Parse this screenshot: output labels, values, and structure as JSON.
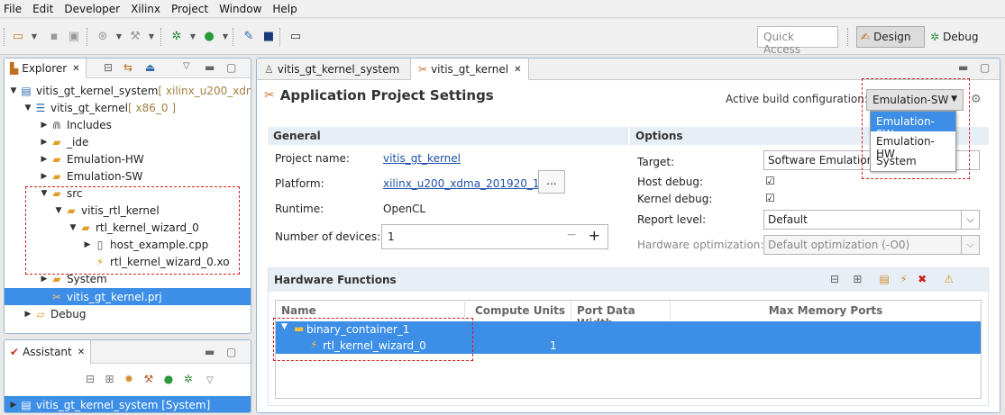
{
  "menu": [
    "File",
    "Edit",
    "Developer",
    "Xilinx",
    "Project",
    "Window",
    "Help"
  ],
  "toolbar": {
    "quick_access_placeholder": "Quick Access",
    "design_label": "Design",
    "debug_label": "Debug"
  },
  "explorer": {
    "tab_label": "Explorer",
    "tree": [
      {
        "label": "vitis_gt_kernel_system",
        "suffix": " [ xilinx_u200_xdm"
      },
      {
        "label": "vitis_gt_kernel",
        "suffix": " [ x86_0 ]"
      },
      {
        "label": "Includes"
      },
      {
        "label": "_ide"
      },
      {
        "label": "Emulation-HW"
      },
      {
        "label": "Emulation-SW"
      },
      {
        "label": "src"
      },
      {
        "label": "vitis_rtl_kernel"
      },
      {
        "label": "rtl_kernel_wizard_0"
      },
      {
        "label": "host_example.cpp"
      },
      {
        "label": "rtl_kernel_wizard_0.xo"
      },
      {
        "label": "System"
      },
      {
        "label": "vitis_gt_kernel.prj"
      },
      {
        "label": "Debug"
      }
    ]
  },
  "assistant": {
    "tab_label": "Assistant",
    "item": "vitis_gt_kernel_system [System]"
  },
  "editor": {
    "tabs": [
      "vitis_gt_kernel_system",
      "vitis_gt_kernel"
    ],
    "title": "Application Project Settings",
    "active_build_label": "Active build configuration:",
    "active_build_value": "Emulation-SW",
    "build_options": [
      "Emulation-SW",
      "Emulation-HW",
      "System"
    ],
    "general": {
      "header": "General",
      "project_name_label": "Project name:",
      "project_name": "vitis_gt_kernel",
      "platform_label": "Platform:",
      "platform": "xilinx_u200_xdma_201920_1",
      "platform_btn": "...",
      "runtime_label": "Runtime:",
      "runtime": "OpenCL",
      "devices_label": "Number of devices:",
      "devices": "1"
    },
    "options": {
      "header": "Options",
      "target_label": "Target:",
      "target": "Software Emulation",
      "host_debug_label": "Host debug:",
      "kernel_debug_label": "Kernel debug:",
      "report_level_label": "Report level:",
      "report_level": "Default",
      "hw_opt_label": "Hardware optimization:",
      "hw_opt": "Default optimization (-O0)"
    },
    "hardware_functions": {
      "header": "Hardware Functions",
      "columns": [
        "Name",
        "Compute Units",
        "Port Data Width",
        "Max Memory Ports"
      ],
      "rows": [
        {
          "name": "binary_container_1",
          "compute_units": ""
        },
        {
          "name": "rtl_kernel_wizard_0",
          "compute_units": "1"
        }
      ]
    }
  }
}
